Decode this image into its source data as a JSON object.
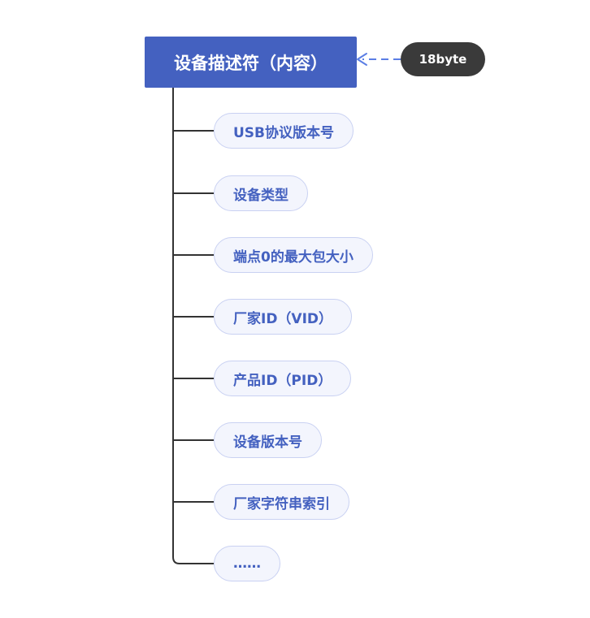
{
  "root": {
    "label": "设备描述符（内容）"
  },
  "badge": {
    "label": "18byte"
  },
  "children": [
    {
      "label": "USB协议版本号"
    },
    {
      "label": "设备类型"
    },
    {
      "label": "端点0的最大包大小"
    },
    {
      "label": "厂家ID（VID）"
    },
    {
      "label": "产品ID（PID）"
    },
    {
      "label": "设备版本号"
    },
    {
      "label": "厂家字符串索引"
    },
    {
      "label": "……"
    }
  ],
  "colors": {
    "root_fill": "#4461c0",
    "badge_fill": "#3a3a3a",
    "child_fill": "#f3f5fd",
    "child_border": "#c9d1f2",
    "child_text": "#4461c0",
    "connector": "#333333",
    "arrow": "#5b7ee5"
  }
}
